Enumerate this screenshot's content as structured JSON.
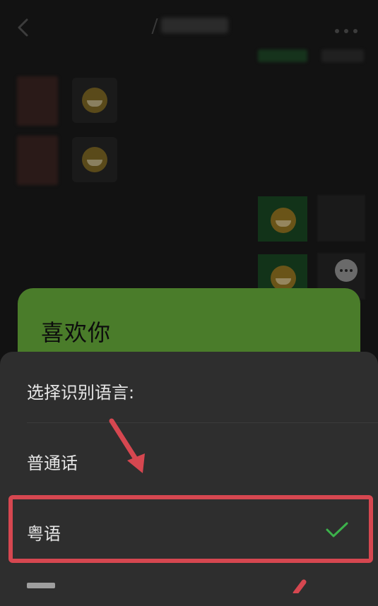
{
  "chat": {
    "voice_message_text": "喜欢你"
  },
  "language_sheet": {
    "title": "选择识别语言:",
    "options": [
      {
        "label": "普通话",
        "selected": false
      },
      {
        "label": "粤语",
        "selected": true
      }
    ]
  },
  "colors": {
    "sheet_background": "#2e2e2e",
    "bubble_green": "#4a7c2a",
    "check_green": "#3cb24b",
    "annotation_red": "#d64750"
  },
  "icons": {
    "back": "chevron-left-icon",
    "more": "more-dots-icon",
    "selected": "check-icon"
  }
}
